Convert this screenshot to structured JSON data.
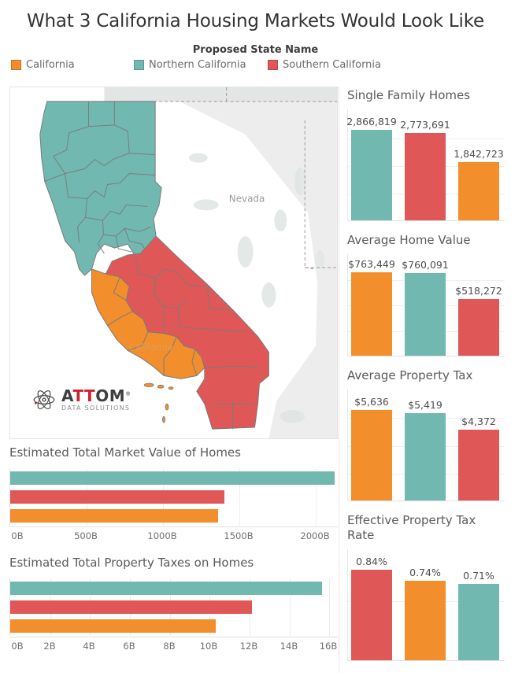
{
  "header": {
    "title": "What 3 California Housing Markets Would Look Like",
    "legend_title": "Proposed State Name",
    "legend": [
      {
        "label": "California",
        "color": "#f28e2b"
      },
      {
        "label": "Northern California",
        "color": "#71b8b1"
      },
      {
        "label": "Southern California",
        "color": "#e05758"
      }
    ]
  },
  "map": {
    "name": "california-proposed-states-map",
    "state_labels": [
      "Nevada",
      "California"
    ],
    "logo": {
      "brand": "ATTOM",
      "brand_prefix": "A",
      "brand_accent": "TT",
      "brand_suffix": "OM",
      "registered": "®",
      "tagline": "DATA SOLUTIONS"
    },
    "colors": {
      "california": "#f28e2b",
      "northern_california": "#71b8b1",
      "southern_california": "#e05758",
      "other_land": "#e9eaea",
      "neighbor_fill": "#ededed",
      "county_border": "#8a8a8a"
    }
  },
  "chart_data": [
    {
      "name": "single-family-homes",
      "type": "bar",
      "orientation": "vertical",
      "title": "Single Family Homes",
      "categories": [
        "Northern California",
        "Southern California",
        "California"
      ],
      "values": [
        2866819,
        2773691,
        1842723
      ],
      "labels": [
        "2,866,819",
        "2,773,691",
        "1,842,723"
      ],
      "colors": [
        "#71b8b1",
        "#e05758",
        "#f28e2b"
      ],
      "ylim": [
        0,
        3200000
      ],
      "grid": true,
      "xlabel": "",
      "ylabel": ""
    },
    {
      "name": "average-home-value",
      "type": "bar",
      "orientation": "vertical",
      "title": "Average Home  Value",
      "categories": [
        "California",
        "Northern California",
        "Southern California"
      ],
      "values": [
        763449,
        760091,
        518272
      ],
      "labels": [
        "$763,449",
        "$760,091",
        "$518,272"
      ],
      "colors": [
        "#f28e2b",
        "#71b8b1",
        "#e05758"
      ],
      "ylim": [
        0,
        850000
      ],
      "grid": true,
      "xlabel": "",
      "ylabel": ""
    },
    {
      "name": "average-property-tax",
      "type": "bar",
      "orientation": "vertical",
      "title": "Average Property Tax",
      "categories": [
        "California",
        "Northern California",
        "Southern California"
      ],
      "values": [
        5636,
        5419,
        4372
      ],
      "labels": [
        "$5,636",
        "$5,419",
        "$4,372"
      ],
      "colors": [
        "#f28e2b",
        "#71b8b1",
        "#e05758"
      ],
      "ylim": [
        0,
        6300
      ],
      "grid": true,
      "xlabel": "",
      "ylabel": ""
    },
    {
      "name": "effective-property-tax-rate",
      "type": "bar",
      "orientation": "vertical",
      "title": "Effective Property Tax Rate",
      "categories": [
        "Southern California",
        "California",
        "Northern California"
      ],
      "values": [
        0.84,
        0.74,
        0.71
      ],
      "labels": [
        "0.84%",
        "0.74%",
        "0.71%"
      ],
      "colors": [
        "#e05758",
        "#f28e2b",
        "#71b8b1"
      ],
      "ylim": [
        0,
        0.95
      ],
      "grid": true,
      "xlabel": "",
      "ylabel": ""
    },
    {
      "name": "estimated-total-market-value-of-homes",
      "type": "bar",
      "orientation": "horizontal",
      "title": "Estimated Total Market Value of Homes",
      "categories": [
        "Northern California",
        "Southern California",
        "California"
      ],
      "values": [
        2180,
        1440,
        1395
      ],
      "colors": [
        "#71b8b1",
        "#e05758",
        "#f28e2b"
      ],
      "xlim": [
        0,
        2300
      ],
      "ticks": [
        0,
        500,
        1000,
        1500,
        2000
      ],
      "tick_labels": [
        "0B",
        "500B",
        "1000B",
        "1500B",
        "2000B"
      ],
      "grid": true,
      "xlabel": "",
      "ylabel": ""
    },
    {
      "name": "estimated-total-property-taxes-on-homes",
      "type": "bar",
      "orientation": "horizontal",
      "title": "Estimated Total Property Taxes on Homes",
      "categories": [
        "Northern California",
        "Southern California",
        "California"
      ],
      "values": [
        15.6,
        12.1,
        10.3
      ],
      "colors": [
        "#71b8b1",
        "#e05758",
        "#f28e2b"
      ],
      "xlim": [
        0,
        16.4
      ],
      "ticks": [
        0,
        2,
        4,
        6,
        8,
        10,
        12,
        14,
        16
      ],
      "tick_labels": [
        "0B",
        "2B",
        "4B",
        "6B",
        "8B",
        "10B",
        "12B",
        "14B",
        "16B"
      ],
      "grid": true,
      "xlabel": "",
      "ylabel": ""
    }
  ]
}
